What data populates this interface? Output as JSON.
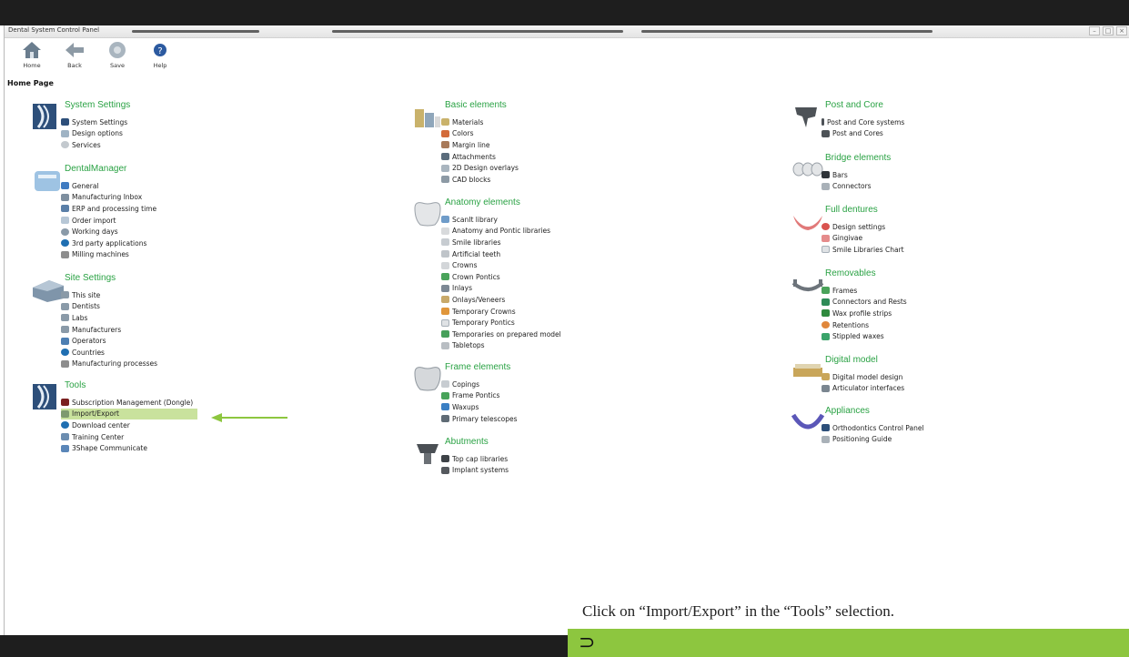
{
  "window": {
    "title": "Dental System Control Panel"
  },
  "toolbar": {
    "home": "Home",
    "back": "Back",
    "save": "Save",
    "help": "Help"
  },
  "page_heading": "Home Page",
  "columns": {
    "left": {
      "system_settings": {
        "title": "System Settings",
        "items": [
          "System Settings",
          "Design options",
          "Services"
        ]
      },
      "dental_manager": {
        "title": "DentalManager",
        "items": [
          "General",
          "Manufacturing Inbox",
          "ERP and processing time",
          "Order import",
          "Working days",
          "3rd party applications",
          "Milling machines"
        ]
      },
      "site_settings": {
        "title": "Site Settings",
        "items": [
          "This site",
          "Dentists",
          "Labs",
          "Manufacturers",
          "Operators",
          "Countries",
          "Manufacturing processes"
        ]
      },
      "tools": {
        "title": "Tools",
        "items": [
          "Subscription Management (Dongle)",
          "Import/Export",
          "Download center",
          "Training Center",
          "3Shape Communicate"
        ]
      }
    },
    "middle": {
      "basic": {
        "title": "Basic elements",
        "items": [
          "Materials",
          "Colors",
          "Margin line",
          "Attachments",
          "2D Design overlays",
          "CAD blocks"
        ]
      },
      "anatomy": {
        "title": "Anatomy elements",
        "items": [
          "ScanIt library",
          "Anatomy and Pontic libraries",
          "Smile libraries",
          "Artificial teeth",
          "Crowns",
          "Crown Pontics",
          "Inlays",
          "Onlays/Veneers",
          "Temporary Crowns",
          "Temporary Pontics",
          "Temporaries on prepared model",
          "Tabletops"
        ]
      },
      "frame": {
        "title": "Frame elements",
        "items": [
          "Copings",
          "Frame Pontics",
          "Waxups",
          "Primary telescopes"
        ]
      },
      "abutments": {
        "title": "Abutments",
        "items": [
          "Top cap libraries",
          "Implant systems"
        ]
      }
    },
    "right": {
      "post_core": {
        "title": "Post and Core",
        "items": [
          "Post and Core systems",
          "Post and Cores"
        ]
      },
      "bridge": {
        "title": "Bridge elements",
        "items": [
          "Bars",
          "Connectors"
        ]
      },
      "dentures": {
        "title": "Full dentures",
        "items": [
          "Design settings",
          "Gingivae",
          "Smile Libraries Chart"
        ]
      },
      "removables": {
        "title": "Removables",
        "items": [
          "Frames",
          "Connectors and Rests",
          "Wax profile strips",
          "Retentions",
          "Stippled waxes"
        ]
      },
      "digital_model": {
        "title": "Digital model",
        "items": [
          "Digital model design",
          "Articulator interfaces"
        ]
      },
      "appliances": {
        "title": "Appliances",
        "items": [
          "Orthodontics Control Panel",
          "Positioning Guide"
        ]
      }
    }
  },
  "caption": "Click on “Import/Export” in the “Tools” selection.",
  "footer_chevron": "⊃",
  "colors": {
    "accent_green": "#2aa244",
    "highlight": "#c9e29d",
    "footer_green": "#8dc63f",
    "arrow": "#8dc63f"
  }
}
